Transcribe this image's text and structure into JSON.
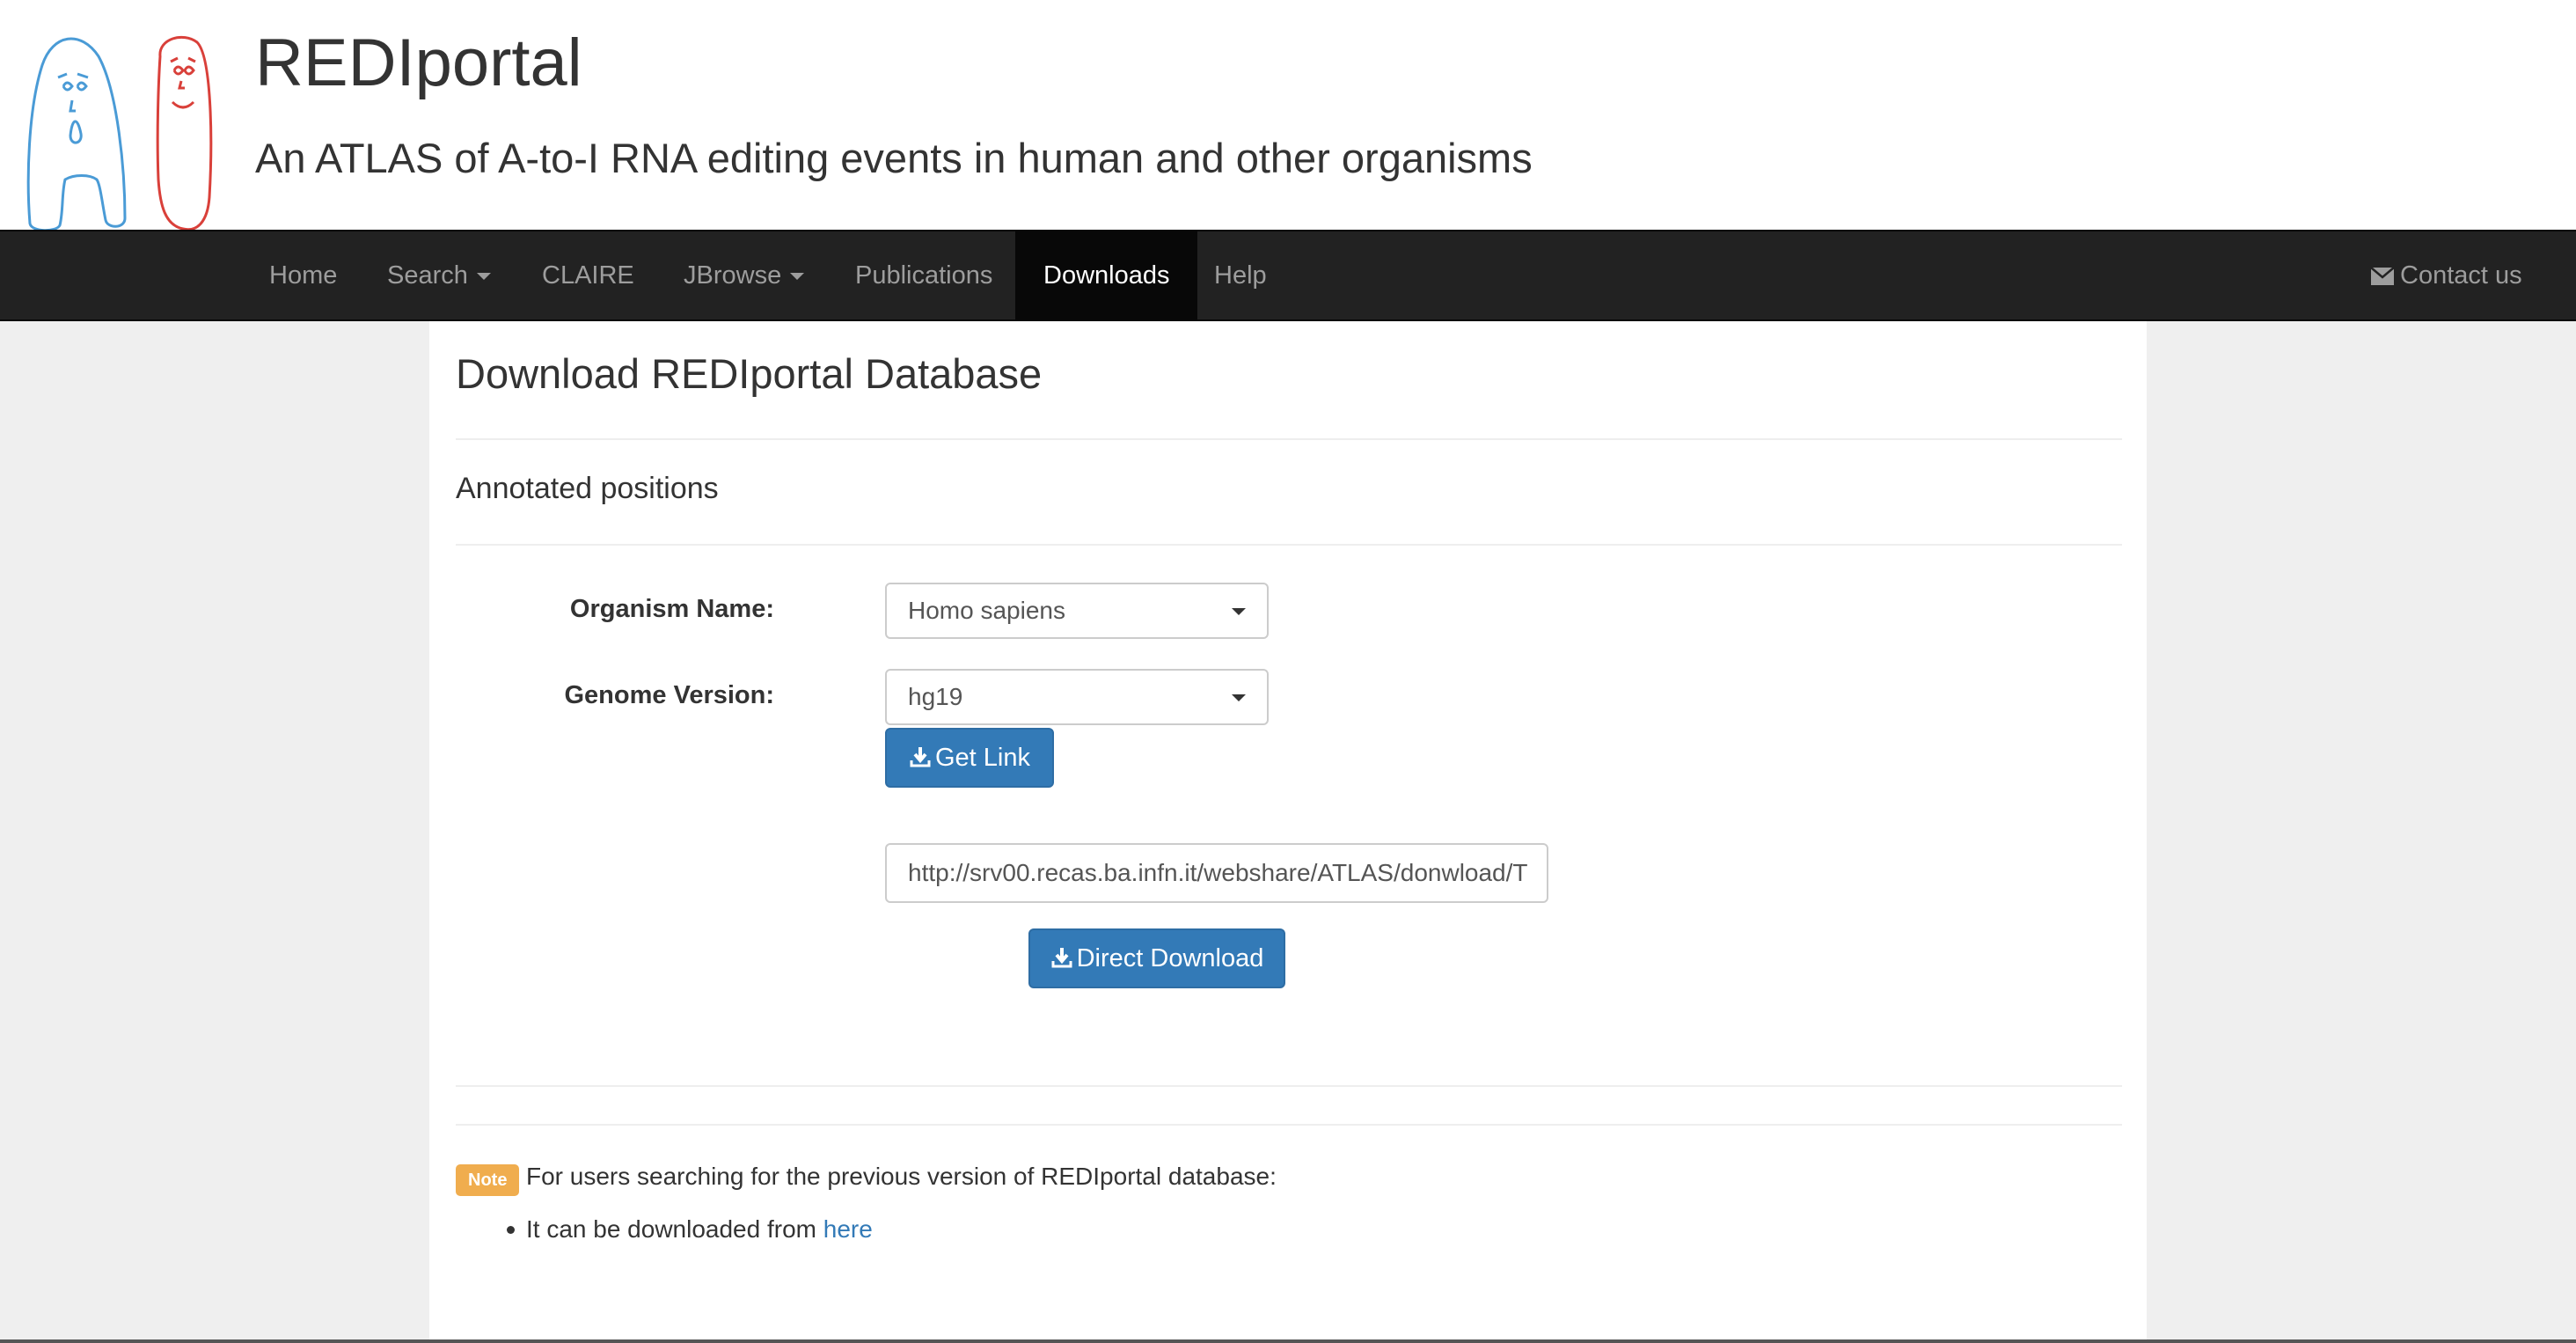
{
  "header": {
    "title": "REDIportal",
    "subtitle": "An ATLAS of A-to-I RNA editing events in human and other organisms"
  },
  "nav": {
    "items": [
      {
        "label": "Home"
      },
      {
        "label": "Search"
      },
      {
        "label": "CLAIRE"
      },
      {
        "label": "JBrowse"
      },
      {
        "label": "Publications"
      },
      {
        "label": "Downloads"
      },
      {
        "label": "Help"
      }
    ],
    "active": "Downloads",
    "contact_label": "Contact us"
  },
  "page": {
    "title": "Download REDIportal Database",
    "section_title": "Annotated positions",
    "form": {
      "organism_label": "Organism Name:",
      "organism_value": "Homo sapiens",
      "genome_label": "Genome Version:",
      "genome_value": "hg19",
      "get_link_label": "Get Link",
      "url_value": "http://srv00.recas.ba.infn.it/webshare/ATLAS/donwload/T",
      "direct_download_label": "Direct Download"
    },
    "note": {
      "badge": "Note",
      "text": "For users searching for the previous version of REDIportal database:",
      "list_item_prefix": "It can be downloaded from ",
      "link_text": "here"
    }
  },
  "icons": {
    "download": "download-icon",
    "envelope": "envelope-icon",
    "caret": "caret-down-icon"
  },
  "colors": {
    "navbar": "#222222",
    "nav_active": "#080808",
    "primary_button": "#337ab7",
    "note_badge": "#f0ad4e",
    "link": "#337ab7"
  }
}
